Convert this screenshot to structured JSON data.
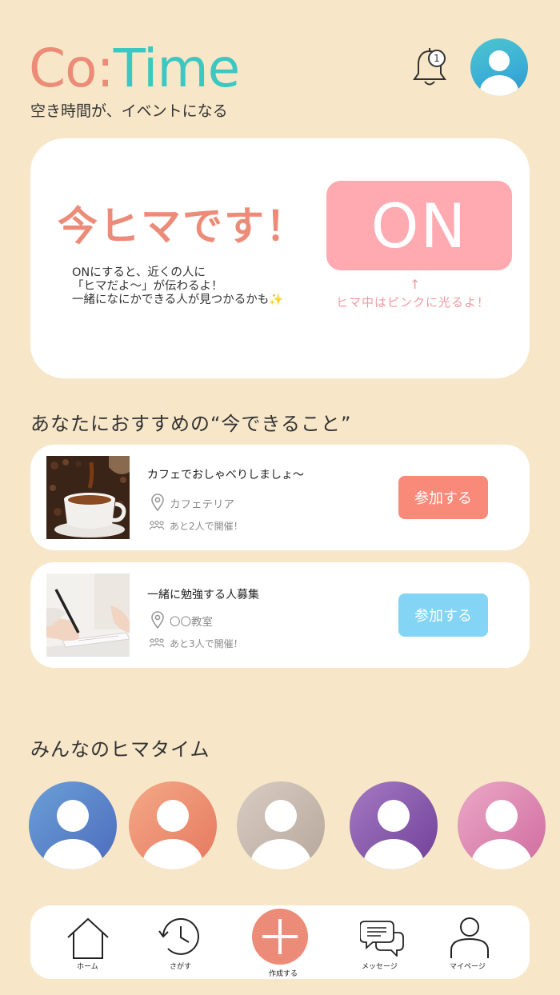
{
  "header": {
    "logo_co": "Co:",
    "logo_time": "Time",
    "tagline": "空き時間が、イベントになる",
    "notification_count": "1"
  },
  "status": {
    "title": "今ヒマです！",
    "description": [
      "ONにすると、近くの人に",
      "「ヒマだよ〜」が伝わるよ！",
      "一緒になにかできる人が見つかるかも✨"
    ],
    "toggle_label": "ON",
    "arrow": "↑",
    "hint": "ヒマ中はピンクに光るよ！"
  },
  "recommend": {
    "section_title": "あなたにおすすめの“今できること”",
    "events": [
      {
        "title": "カフェでおしゃべりしましょ〜",
        "place": "カフェテリア",
        "people": "あと2人で開催！",
        "join_label": "参加する",
        "button_color": "#f98a7a",
        "thumb": "coffee-cup-image"
      },
      {
        "title": "一緒に勉強する人募集",
        "place": "〇〇教室",
        "people": "あと3人で開催！",
        "join_label": "参加する",
        "button_color": "#84d4f5",
        "thumb": "writing-notebook-image"
      }
    ]
  },
  "members": {
    "section_title": "みんなのヒマタイム",
    "colors": [
      "#5a87c9",
      "#ea8f6f",
      "#c9b9ad",
      "#8a5aa8",
      "#d97aa6"
    ]
  },
  "nav": {
    "items": [
      {
        "label": "ホーム",
        "icon": "home-icon"
      },
      {
        "label": "さがす",
        "icon": "history-clock-icon"
      },
      {
        "label": "作成する",
        "icon": "plus-icon"
      },
      {
        "label": "メッセージ",
        "icon": "chat-icon"
      },
      {
        "label": "マイページ",
        "icon": "person-icon"
      }
    ]
  },
  "colors": {
    "background": "#f7e7c8",
    "accent_salmon": "#ec8c78",
    "accent_teal": "#3cc7c2",
    "on_pink": "#ffa9b0"
  }
}
